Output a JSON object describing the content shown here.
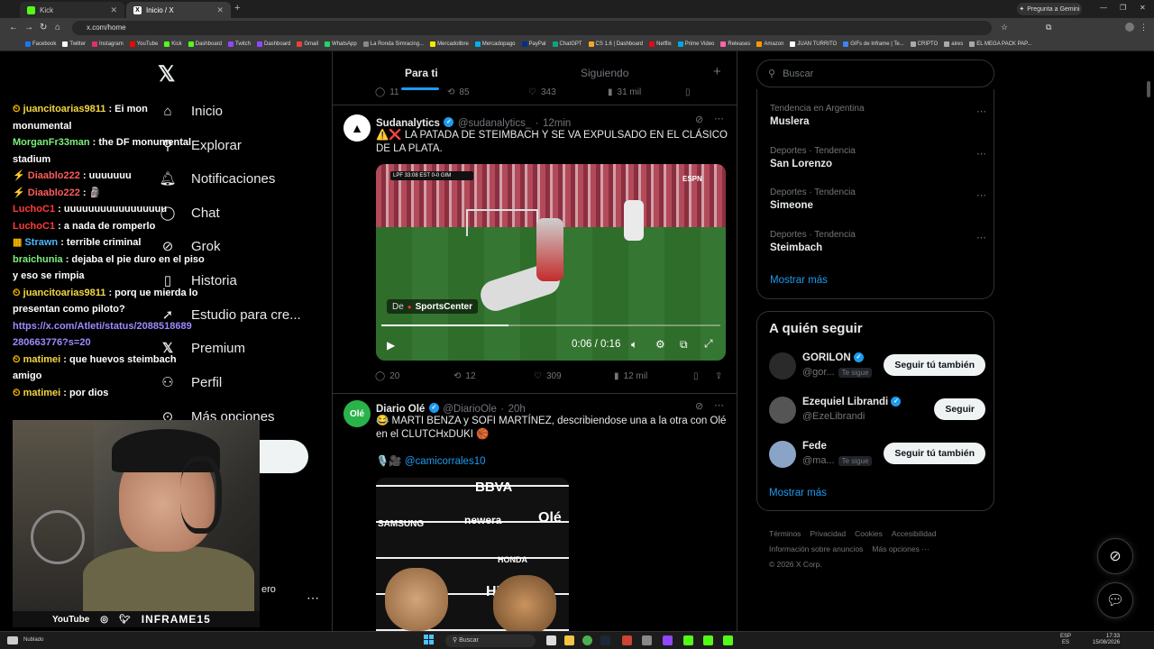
{
  "browser": {
    "tabs": [
      {
        "title": "Kick",
        "color": "#53fc18"
      },
      {
        "title": "Inicio / X",
        "color": "#ffffff"
      }
    ],
    "gemini_label": "Pregunta a Gemini",
    "url": "x.com/home",
    "bookmarks": [
      {
        "label": "Facebook",
        "color": "#1877f2"
      },
      {
        "label": "Twitter",
        "color": "#ffffff"
      },
      {
        "label": "Instagram",
        "color": "#e1306c"
      },
      {
        "label": "YouTube",
        "color": "#ff0000"
      },
      {
        "label": "Kick",
        "color": "#53fc18"
      },
      {
        "label": "Dashboard",
        "color": "#53fc18"
      },
      {
        "label": "Twitch",
        "color": "#9146ff"
      },
      {
        "label": "Dashboard",
        "color": "#9146ff"
      },
      {
        "label": "Gmail",
        "color": "#ea4335"
      },
      {
        "label": "WhatsApp",
        "color": "#25d366"
      },
      {
        "label": "La Ronda Simracing...",
        "color": "#888888"
      },
      {
        "label": "Mercadolibre",
        "color": "#ffe600"
      },
      {
        "label": "Mercadopago",
        "color": "#00b1ea"
      },
      {
        "label": "PayPal",
        "color": "#003087"
      },
      {
        "label": "ChatGPT",
        "color": "#10a37f"
      },
      {
        "label": "CS 1.6 | Dashboard",
        "color": "#f5a623"
      },
      {
        "label": "Netflix",
        "color": "#e50914"
      },
      {
        "label": "Prime Video",
        "color": "#00a8e1"
      },
      {
        "label": "Releases",
        "color": "#ff66aa"
      },
      {
        "label": "Amazon",
        "color": "#ff9900"
      },
      {
        "label": "JUAN TURRITO",
        "color": "#ffffff"
      },
      {
        "label": "GIFs de Inframe | Te...",
        "color": "#3b82f6"
      },
      {
        "label": "CRIPTO",
        "color": "#aaaaaa"
      },
      {
        "label": "aires",
        "color": "#aaaaaa"
      },
      {
        "label": "EL MEGA PACK PAP...",
        "color": "#aaaaaa"
      }
    ]
  },
  "chat": [
    {
      "user": "juancitoarias9811",
      "msg": ": Ei mon",
      "color": "#f5d742",
      "badge": "clock"
    },
    {
      "user": "",
      "msg": "monumental",
      "color": "#ffffff",
      "badge": ""
    },
    {
      "user": "MorganFr33man",
      "msg": ": the DF monumental",
      "color": "#7ef07e",
      "badge": ""
    },
    {
      "user": "",
      "msg": "stadium",
      "color": "#ffffff",
      "badge": ""
    },
    {
      "user": "Diaablo222",
      "msg": ": uuuuuuu",
      "color": "#ff5c5c",
      "badge": "bolt"
    },
    {
      "user": "Diaablo222",
      "msg": ": 🗿",
      "color": "#ff5c5c",
      "badge": "bolt"
    },
    {
      "user": "LuchoC1",
      "msg": ": uuuuuuuuuuuuuuuuu",
      "color": "#ff3b3b",
      "badge": ""
    },
    {
      "user": "LuchoC1",
      "msg": ": a nada de romperlo",
      "color": "#ff3b3b",
      "badge": ""
    },
    {
      "user": "Strawn",
      "msg": ": terrible criminal",
      "color": "#4fb8ff",
      "badge": "grid"
    },
    {
      "user": "braichunia",
      "msg": ": dejaba el pie duro en el piso",
      "color": "#7ef07e",
      "badge": ""
    },
    {
      "user": "",
      "msg": "y eso se rimpia",
      "color": "#ffffff",
      "badge": ""
    },
    {
      "user": "juancitoarias9811",
      "msg": ": porq ue mierda lo",
      "color": "#f5d742",
      "badge": "clock"
    },
    {
      "user": "",
      "msg": "presentan como piloto?",
      "color": "#ffffff",
      "badge": ""
    },
    {
      "user": "",
      "msg": "https://x.com/Atleti/status/2088518689",
      "color": "#9b8cff",
      "badge": ""
    },
    {
      "user": "",
      "msg": "280663776?s=20",
      "color": "#9b8cff",
      "badge": ""
    },
    {
      "user": "matimei",
      "msg": ": que huevos steimbach",
      "color": "#f5d742",
      "badge": "clock"
    },
    {
      "user": "",
      "msg": "amigo",
      "color": "#ffffff",
      "badge": ""
    },
    {
      "user": "matimei",
      "msg": ": por dios",
      "color": "#f5d742",
      "badge": "clock"
    }
  ],
  "nav": {
    "items": [
      "Inicio",
      "Explorar",
      "Notificaciones",
      "Chat",
      "Grok",
      "Historia",
      "Estudio para cre...",
      "Premium",
      "Perfil",
      "Más opciones"
    ],
    "profile_fragment": "ero",
    "more_icon": "⋯"
  },
  "stream_overlay": {
    "youtube": "YouTube",
    "brand": "INFRAME15"
  },
  "feed": {
    "tabs": [
      "Para ti",
      "Siguiendo"
    ],
    "top_actions": {
      "comments": "11",
      "reposts": "85",
      "likes": "343",
      "views": "31 mil"
    },
    "tweet1": {
      "name": "Sudanalytics",
      "handle": "@sudanalytics_",
      "time": "12min",
      "text": "⚠️❌ LA PATADA DE STEIMBACH Y SE VA EXPULSADO EN EL CLÁSICO DE LA PLATA.",
      "video": {
        "from_label": "De",
        "source": "SportsCenter",
        "time": "0:06 / 0:16",
        "progress": 0.375,
        "scorebug": "LPF  33:08  EST 0-0 GIM",
        "broadcaster": "ESPN"
      },
      "stats": {
        "comments": "20",
        "reposts": "12",
        "likes": "309",
        "views": "12 mil"
      }
    },
    "tweet2": {
      "name": "Diario Olé",
      "handle": "@DiarioOle",
      "time": "20h",
      "text": "😂 MARTI BENZA y SOFI MARTÍNEZ, describiendose una a la otra con Olé en el CLUTCHxDUKI 🏀",
      "mention": "🎙️🎥 @camicorrales10",
      "image_words": [
        "BBVA",
        "SAMSUNG",
        "newera",
        "Olé",
        "HONDA",
        "HE"
      ]
    }
  },
  "right": {
    "search_placeholder": "Buscar",
    "trends": [
      {
        "category": "Tendencia en Argentina",
        "name": "Muslera"
      },
      {
        "category": "Deportes · Tendencia",
        "name": "San Lorenzo"
      },
      {
        "category": "Deportes · Tendencia",
        "name": "Simeone"
      },
      {
        "category": "Deportes · Tendencia",
        "name": "Steimbach"
      }
    ],
    "trends_more": "Mostrar más",
    "follow_title": "A quién seguir",
    "follow": [
      {
        "name": "GORILON",
        "handle": "@gor...",
        "follows_you": "Te sigue",
        "button": "Seguir tú también",
        "verified": true,
        "avatar": "#2a2a2a"
      },
      {
        "name": "Ezequiel Librandi",
        "handle": "@EzeLibrandi",
        "follows_you": "",
        "button": "Seguir",
        "verified": true,
        "avatar": "#555555"
      },
      {
        "name": "Fede",
        "handle": "@ma...",
        "follows_you": "Te sigue",
        "button": "Seguir tú también",
        "verified": false,
        "avatar": "#8aa4c8"
      }
    ],
    "follow_more": "Mostrar más",
    "footer": [
      "Términos",
      "Privacidad",
      "Cookies",
      "Accesibilidad",
      "Información sobre anuncios",
      "Más opciones ···",
      "© 2026 X Corp."
    ]
  },
  "taskbar": {
    "weather": "Nublado",
    "search": "Buscar",
    "lang_top": "ESP",
    "lang_bottom": "ES",
    "time": "17:33",
    "date": "15/08/2026"
  }
}
